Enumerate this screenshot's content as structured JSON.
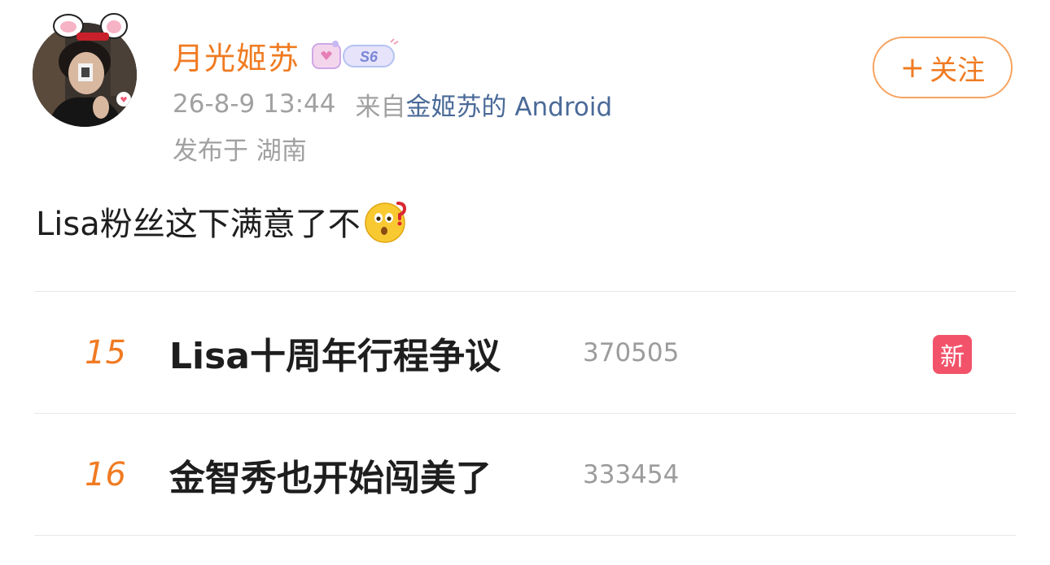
{
  "user": {
    "name": "月光姬苏",
    "vip_level": "S6",
    "avatar_icon": "user-avatar-photo",
    "badge_icon": "vip-level-badge"
  },
  "post_meta": {
    "time": "26-8-9 13:44",
    "from_prefix": "来自",
    "device": "金姬苏的 Android",
    "location": "发布于 湖南"
  },
  "follow_button": {
    "plus": "+",
    "label": "关注"
  },
  "post": {
    "text": "Lisa粉丝这下满意了不",
    "emoji_icon": "thinking-question-face-emoji"
  },
  "trends": [
    {
      "rank": "15",
      "title": "Lisa十周年行程争议",
      "heat": "370505",
      "badge": "新"
    },
    {
      "rank": "16",
      "title": "金智秀也开始闯美了",
      "heat": "333454",
      "badge": ""
    }
  ],
  "colors": {
    "accent": "#f07b22",
    "link": "#4a6a98",
    "meta": "#a1a1a1",
    "new_badge": "#f2536a"
  }
}
